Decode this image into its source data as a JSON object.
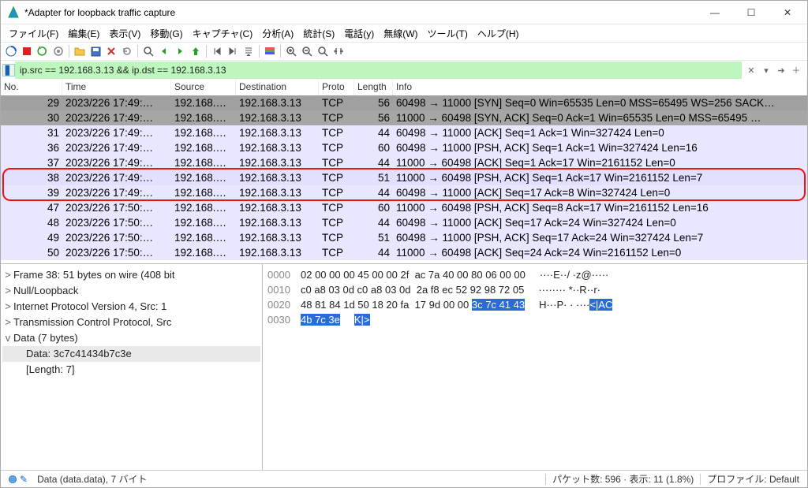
{
  "window": {
    "title": "*Adapter for loopback traffic capture"
  },
  "menu": [
    "ファイル(F)",
    "編集(E)",
    "表示(V)",
    "移動(G)",
    "キャプチャ(C)",
    "分析(A)",
    "統計(S)",
    "電話(y)",
    "無線(W)",
    "ツール(T)",
    "ヘルプ(H)"
  ],
  "filter": {
    "value": "ip.src == 192.168.3.13 && ip.dst == 192.168.3.13"
  },
  "columns": {
    "no": "No.",
    "time": "Time",
    "src": "Source",
    "dst": "Destination",
    "proto": "Proto",
    "len": "Length",
    "info": "Info"
  },
  "packets": [
    {
      "no": "29",
      "time": "2023/226 17:49:…",
      "src": "192.168.…",
      "dst": "192.168.3.13",
      "proto": "TCP",
      "len": "56",
      "info": "60498 → 11000 [SYN] Seq=0 Win=65535 Len=0 MSS=65495 WS=256 SACK…",
      "cls": "r-syn"
    },
    {
      "no": "30",
      "time": "2023/226 17:49:…",
      "src": "192.168.…",
      "dst": "192.168.3.13",
      "proto": "TCP",
      "len": "56",
      "info": "11000 → 60498 [SYN, ACK] Seq=0 Ack=1 Win=65535 Len=0 MSS=65495 …",
      "cls": "r-synack"
    },
    {
      "no": "31",
      "time": "2023/226 17:49:…",
      "src": "192.168.…",
      "dst": "192.168.3.13",
      "proto": "TCP",
      "len": "44",
      "info": "60498 → 11000 [ACK] Seq=1 Ack=1 Win=327424 Len=0",
      "cls": "r-light"
    },
    {
      "no": "36",
      "time": "2023/226 17:49:…",
      "src": "192.168.…",
      "dst": "192.168.3.13",
      "proto": "TCP",
      "len": "60",
      "info": "60498 → 11000 [PSH, ACK] Seq=1 Ack=1 Win=327424 Len=16",
      "cls": "r-light"
    },
    {
      "no": "37",
      "time": "2023/226 17:49:…",
      "src": "192.168.…",
      "dst": "192.168.3.13",
      "proto": "TCP",
      "len": "44",
      "info": "11000 → 60498 [ACK] Seq=1 Ack=17 Win=2161152 Len=0",
      "cls": "r-light"
    },
    {
      "no": "38",
      "time": "2023/226 17:49:…",
      "src": "192.168.…",
      "dst": "192.168.3.13",
      "proto": "TCP",
      "len": "51",
      "info": "11000 → 60498 [PSH, ACK] Seq=1 Ack=17 Win=2161152 Len=7",
      "cls": "r-mid"
    },
    {
      "no": "39",
      "time": "2023/226 17:49:…",
      "src": "192.168.…",
      "dst": "192.168.3.13",
      "proto": "TCP",
      "len": "44",
      "info": "60498 → 11000 [ACK] Seq=17 Ack=8 Win=327424 Len=0",
      "cls": "r-light"
    },
    {
      "no": "47",
      "time": "2023/226 17:50:…",
      "src": "192.168.…",
      "dst": "192.168.3.13",
      "proto": "TCP",
      "len": "60",
      "info": "11000 → 60498 [PSH, ACK] Seq=8 Ack=17 Win=2161152 Len=16",
      "cls": "r-light"
    },
    {
      "no": "48",
      "time": "2023/226 17:50:…",
      "src": "192.168.…",
      "dst": "192.168.3.13",
      "proto": "TCP",
      "len": "44",
      "info": "60498 → 11000 [ACK] Seq=17 Ack=24 Win=327424 Len=0",
      "cls": "r-light"
    },
    {
      "no": "49",
      "time": "2023/226 17:50:…",
      "src": "192.168.…",
      "dst": "192.168.3.13",
      "proto": "TCP",
      "len": "51",
      "info": "60498 → 11000 [PSH, ACK] Seq=17 Ack=24 Win=327424 Len=7",
      "cls": "r-light"
    },
    {
      "no": "50",
      "time": "2023/226 17:50:…",
      "src": "192.168.…",
      "dst": "192.168.3.13",
      "proto": "TCP",
      "len": "44",
      "info": "11000 → 60498 [ACK] Seq=24 Ack=24 Win=2161152 Len=0",
      "cls": "r-light"
    }
  ],
  "redbox": {
    "topRow": 5,
    "rows": 2
  },
  "tree": [
    {
      "ind": 0,
      "tog": ">",
      "txt": "Frame 38: 51 bytes on wire (408 bit"
    },
    {
      "ind": 0,
      "tog": ">",
      "txt": "Null/Loopback"
    },
    {
      "ind": 0,
      "tog": ">",
      "txt": "Internet Protocol Version 4, Src: 1"
    },
    {
      "ind": 0,
      "tog": ">",
      "txt": "Transmission Control Protocol, Src"
    },
    {
      "ind": 0,
      "tog": "v",
      "txt": "Data (7 bytes)"
    },
    {
      "ind": 1,
      "tog": "",
      "txt": "Data: 3c7c41434b7c3e",
      "sel": true
    },
    {
      "ind": 1,
      "tog": "",
      "txt": "[Length: 7]"
    }
  ],
  "hex": {
    "rows": [
      {
        "off": "0000",
        "bytes": "02 00 00 00 45 00 00 2f  ac 7a 40 00 80 06 00 00",
        "asc": "····E··/ ·z@·····"
      },
      {
        "off": "0010",
        "bytes": "c0 a8 03 0d c0 a8 03 0d  2a f8 ec 52 92 98 72 05",
        "asc": "········ *··R··r·"
      },
      {
        "off": "0020",
        "bytes": "48 81 84 1d 50 18 20 fa  17 9d 00 00 ",
        "asc": "H···P· · ····",
        "tail_hex": "3c 7c 41 43",
        "tail_asc": "<|AC"
      },
      {
        "off": "0030",
        "bytes": "",
        "tail_hex": "4b 7c 3e",
        "tail_asc": "K|>"
      }
    ]
  },
  "status": {
    "left": "Data (data.data), 7 バイト",
    "middle": "パケット数: 596 · 表示: 11 (1.8%)",
    "right": "プロファイル: Default"
  }
}
